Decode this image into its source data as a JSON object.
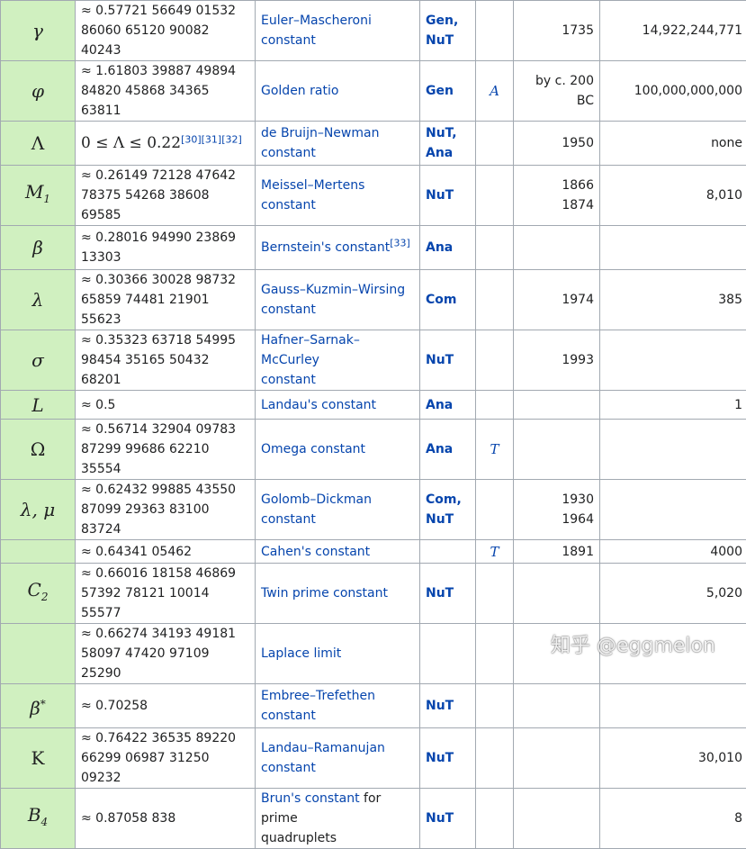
{
  "rows": [
    {
      "symbol": "γ",
      "value": "≈ 0.57721 56649 01532\n86060 65120 90082 40243",
      "name": "Euler–Mascheroni\nconstant",
      "field": "Gen,\nNuT",
      "irr": "",
      "year": "1735",
      "digits": "14,922,244,771"
    },
    {
      "symbol": "φ",
      "value": "≈ 1.61803 39887 49894\n84820 45868 34365 63811",
      "name": "Golden ratio",
      "field": "Gen",
      "irr": "A",
      "year": "by c. 200 BC",
      "digits": "100,000,000,000"
    },
    {
      "symbol": "Λ",
      "value_math": "0 ≤ Λ ≤ 0.22",
      "value_refs": "[30][31][32]",
      "name": "de Bruijn–Newman\nconstant",
      "field": "NuT,\nAna",
      "irr": "",
      "year": "1950",
      "digits": "none"
    },
    {
      "symbol": "M",
      "symbol_sub": "1",
      "value": "≈ 0.26149 72128 47642\n78375 54268 38608 69585",
      "name": "Meissel–Mertens\nconstant",
      "field": "NuT",
      "irr": "",
      "year": "1866\n1874",
      "digits": "8,010"
    },
    {
      "symbol": "β",
      "value": "≈ 0.28016 94990 23869\n13303",
      "name": "Bernstein's constant",
      "name_ref": "[33]",
      "field": "Ana",
      "irr": "",
      "year": "",
      "digits": ""
    },
    {
      "symbol": "λ",
      "value": "≈ 0.30366 30028 98732\n65859 74481 21901 55623",
      "name": "Gauss–Kuzmin–Wirsing\nconstant",
      "field": "Com",
      "irr": "",
      "year": "1974",
      "digits": "385"
    },
    {
      "symbol": "σ",
      "value": "≈ 0.35323 63718 54995\n98454 35165 50432 68201",
      "name": "Hafner–Sarnak–McCurley\nconstant",
      "field": "NuT",
      "irr": "",
      "year": "1993",
      "digits": ""
    },
    {
      "symbol": "L",
      "value": "≈ 0.5",
      "name": "Landau's constant",
      "field": "Ana",
      "irr": "",
      "year": "",
      "digits": "1"
    },
    {
      "symbol": "Ω",
      "value": "≈ 0.56714 32904 09783\n87299 99686 62210 35554",
      "name": "Omega constant",
      "field": "Ana",
      "irr": "T",
      "year": "",
      "digits": ""
    },
    {
      "symbol": "λ, μ",
      "value": "≈ 0.62432 99885 43550\n87099 29363 83100 83724",
      "name": "Golomb–Dickman\nconstant",
      "field": "Com,\nNuT",
      "irr": "",
      "year": "1930\n1964",
      "digits": ""
    },
    {
      "symbol": "",
      "value": "≈ 0.64341 05462",
      "name": "Cahen's constant",
      "field": "",
      "irr": "T",
      "year": "1891",
      "digits": "4000"
    },
    {
      "symbol": "C",
      "symbol_sub": "2",
      "value": "≈ 0.66016 18158 46869\n57392 78121 10014 55577",
      "name": "Twin prime constant",
      "field": "NuT",
      "irr": "",
      "year": "",
      "digits": "5,020"
    },
    {
      "symbol": "",
      "value": "≈ 0.66274 34193 49181\n58097 47420 97109 25290",
      "name": "Laplace limit",
      "field": "",
      "irr": "",
      "year": "",
      "digits": ""
    },
    {
      "symbol": "β",
      "symbol_sup": "*",
      "value": "≈ 0.70258",
      "name": "Embree–Trefethen\nconstant",
      "field": "NuT",
      "irr": "",
      "year": "",
      "digits": ""
    },
    {
      "symbol": "K",
      "value": "≈ 0.76422 36535 89220\n66299 06987 31250 09232",
      "name": "Landau–Ramanujan\nconstant",
      "field": "NuT",
      "irr": "",
      "year": "",
      "digits": "30,010"
    },
    {
      "symbol": "B",
      "symbol_sub": "4",
      "value": "≈ 0.87058 838",
      "name": "Brun's constant",
      "name_suffix": " for prime\nquadruplets",
      "field": "NuT",
      "irr": "",
      "year": "",
      "digits": "8"
    }
  ],
  "watermark": "知乎 @eggmelon"
}
